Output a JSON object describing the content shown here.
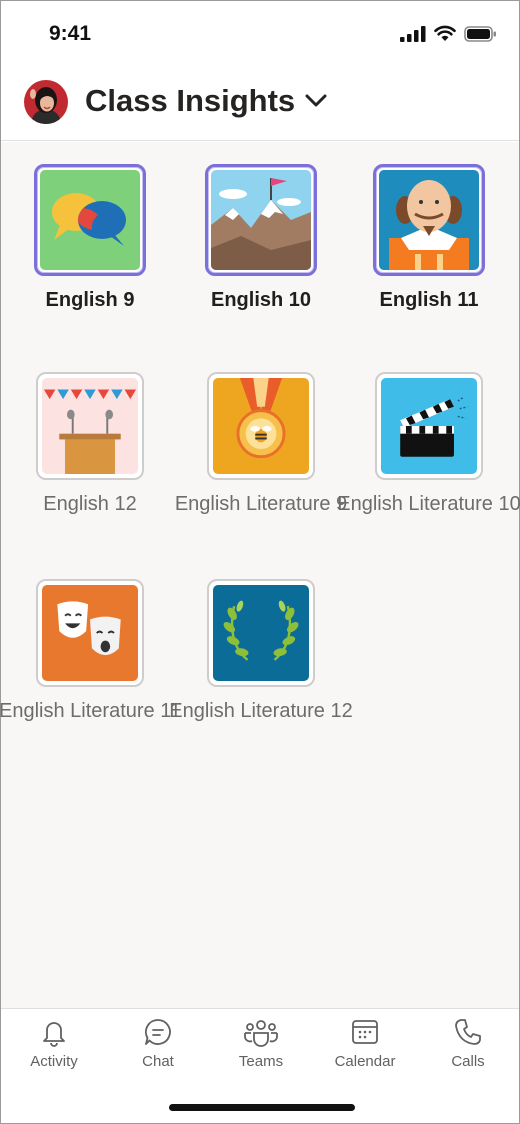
{
  "status_bar": {
    "time": "9:41"
  },
  "header": {
    "title": "Class Insights"
  },
  "classes": [
    {
      "label": "English 9",
      "active": true,
      "icon": "speech-bubbles-icon"
    },
    {
      "label": "English 10",
      "active": true,
      "icon": "mountain-flag-icon"
    },
    {
      "label": "English 11",
      "active": true,
      "icon": "shakespeare-icon"
    },
    {
      "label": "English 12",
      "active": false,
      "icon": "podium-icon"
    },
    {
      "label": "English Literature 9",
      "active": false,
      "icon": "medal-icon"
    },
    {
      "label": "English Literature 10",
      "active": false,
      "icon": "clapperboard-icon"
    },
    {
      "label": "English Literature 11",
      "active": false,
      "icon": "theater-masks-icon"
    },
    {
      "label": "English Literature 12",
      "active": false,
      "icon": "laurel-wreath-icon"
    }
  ],
  "tabs": [
    {
      "label": "Activity",
      "icon": "bell-icon"
    },
    {
      "label": "Chat",
      "icon": "chat-icon"
    },
    {
      "label": "Teams",
      "icon": "teams-icon"
    },
    {
      "label": "Calendar",
      "icon": "calendar-icon"
    },
    {
      "label": "Calls",
      "icon": "phone-icon"
    }
  ],
  "colors": {
    "accent": "#7b6fd9",
    "background": "#f8f7f6",
    "text_primary": "#252423",
    "text_muted": "#6e6c6a"
  }
}
